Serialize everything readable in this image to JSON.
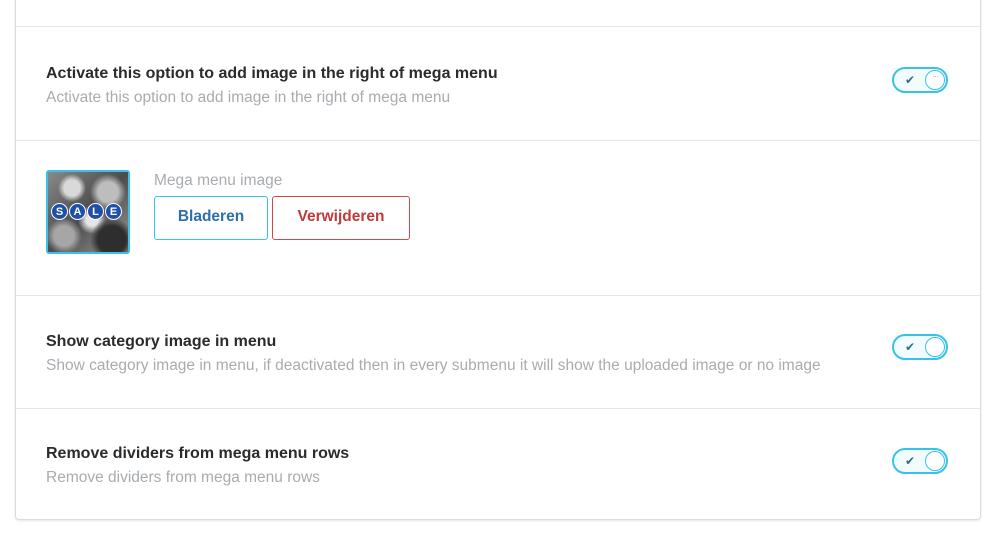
{
  "settings": {
    "right_image": {
      "title": "Activate this option to add image in the right of mega menu",
      "description": "Activate this option to add image in the right of mega menu",
      "enabled": true
    },
    "mega_menu_image": {
      "label": "Mega menu image",
      "thumbnail_text": [
        "S",
        "A",
        "L",
        "E"
      ],
      "browse_label": "Bladeren",
      "remove_label": "Verwijderen"
    },
    "category_image": {
      "title": "Show category image in menu",
      "description": "Show category image in menu, if deactivated then in every submenu it will show the uploaded image or no image",
      "enabled": true
    },
    "remove_dividers": {
      "title": "Remove dividers from mega menu rows",
      "description": "Remove dividers from mega menu rows",
      "enabled": true
    }
  },
  "colors": {
    "accent": "#38c2e8",
    "danger": "#c0393b",
    "link": "#2f6fa8",
    "muted": "#a8acb0"
  },
  "icons": {
    "toggle_on": "check-icon",
    "toggle_knob": "dots-icon"
  }
}
